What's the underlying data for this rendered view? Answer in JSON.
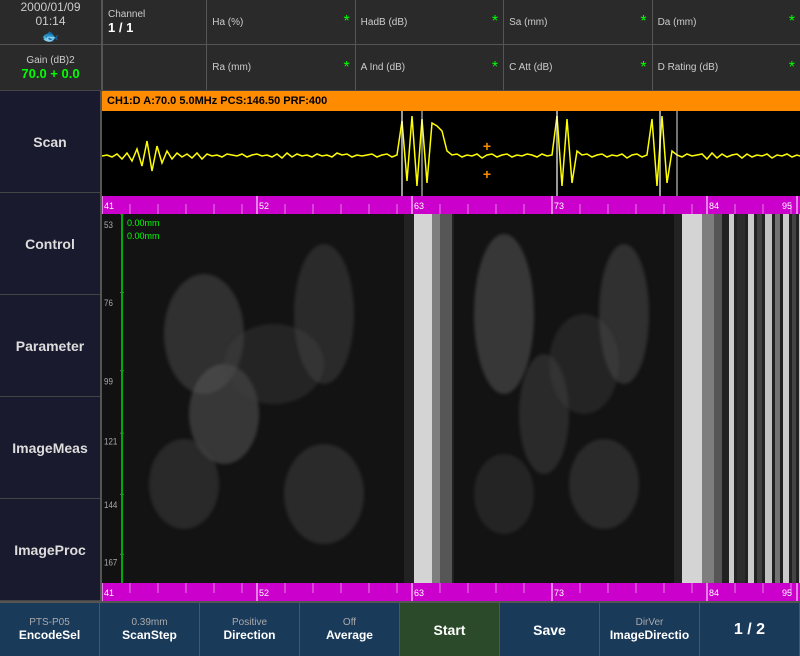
{
  "header": {
    "datetime": {
      "date": "2000/01/09",
      "time": "01:14"
    },
    "gain": {
      "label1": "Gain",
      "label2": "(dB)2",
      "value": "70.0 + 0.0"
    },
    "channel": {
      "label": "Channel",
      "value": "1 / 1"
    },
    "cols": [
      {
        "top_label": "Ha",
        "top_unit": "(%)",
        "top_value": "",
        "bottom_label": "Ra",
        "bottom_unit": "(mm)",
        "bottom_value": "",
        "has_ast_top": true,
        "has_ast_bottom": true
      },
      {
        "top_label": "HadB",
        "top_unit": "(dB)",
        "top_value": "",
        "bottom_label": "A Ind",
        "bottom_unit": "(dB)",
        "bottom_value": "",
        "has_ast_top": true,
        "has_ast_bottom": true
      },
      {
        "top_label": "Sa",
        "top_unit": "(mm)",
        "top_value": "",
        "bottom_label": "C Att",
        "bottom_unit": "(dB)",
        "bottom_value": "",
        "has_ast_top": true,
        "has_ast_bottom": true
      },
      {
        "top_label": "Da",
        "top_unit": "(mm)",
        "top_value": "",
        "bottom_label": "D Rating",
        "bottom_unit": "(dB)",
        "bottom_value": "",
        "has_ast_top": true,
        "has_ast_bottom": true
      }
    ]
  },
  "channel_info_bar": "CH1:D A:70.0 5.0MHz PCS:146.50 PRF:400",
  "sidebar": {
    "items": [
      {
        "label": "Scan"
      },
      {
        "label": "Control"
      },
      {
        "label": "Parameter"
      },
      {
        "label": "ImageMeas"
      },
      {
        "label": "ImageProc"
      }
    ]
  },
  "ruler": {
    "marks": [
      "41",
      "52",
      "63",
      "73",
      "84",
      "95"
    ]
  },
  "depth": {
    "marks": [
      "53",
      "76",
      "99",
      "121",
      "144",
      "167"
    ]
  },
  "mm_display": {
    "line1": "0.00mm",
    "line2": "0.00mm"
  },
  "statusbar": {
    "items": [
      {
        "top": "PTS-P05",
        "bottom": "EncodeSel"
      },
      {
        "top": "0.39mm",
        "bottom": "ScanStep"
      },
      {
        "top": "Positive",
        "bottom": "Direction"
      },
      {
        "top": "Off",
        "bottom": "Average"
      },
      {
        "top": "",
        "bottom": "Start"
      },
      {
        "top": "",
        "bottom": "Save"
      },
      {
        "top": "DirVer",
        "bottom": "ImageDirectio"
      },
      {
        "top": "",
        "bottom": "1 / 2"
      }
    ]
  },
  "colors": {
    "accent_green": "#00ff00",
    "accent_orange": "#ff8c00",
    "ruler_purple": "#cc00cc",
    "sidebar_bg": "#1a1a2e",
    "header_bg": "#2a2a2a"
  }
}
